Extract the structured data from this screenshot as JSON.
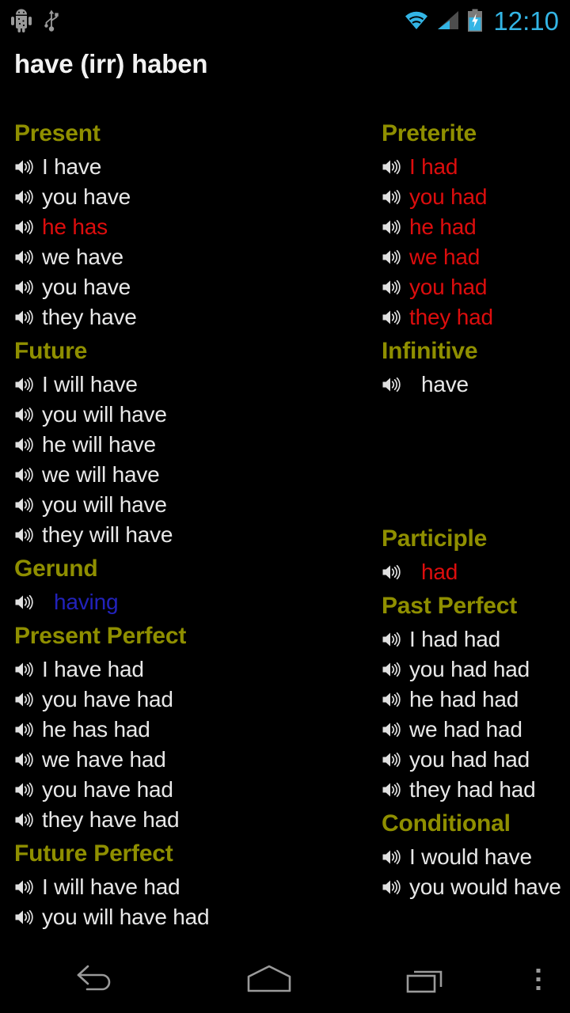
{
  "statusbar": {
    "icons": [
      "android-debug-icon",
      "usb-icon",
      "wifi-icon",
      "cellular-signal-icon",
      "battery-charging-icon"
    ],
    "clock": "12:10",
    "accent_color": "#33b5e5"
  },
  "header": {
    "title": "have (irr) haben"
  },
  "colors": {
    "section_heading": "#8f8f00",
    "regular_form": "#e8e8e8",
    "irregular_form": "#dd0d0d",
    "gerund_form": "#2222bb",
    "background": "#000000"
  },
  "icons": {
    "speaker": "speaker-icon",
    "back": "back-icon",
    "home": "home-icon",
    "recent": "recent-apps-icon",
    "menu": "overflow-menu-icon"
  },
  "left_column": [
    {
      "heading": "Present",
      "rows": [
        {
          "text": "I have",
          "color": "regular"
        },
        {
          "text": "you have",
          "color": "regular"
        },
        {
          "text": "he has",
          "color": "irregular"
        },
        {
          "text": "we have",
          "color": "regular"
        },
        {
          "text": "you have",
          "color": "regular"
        },
        {
          "text": "they have",
          "color": "regular"
        }
      ]
    },
    {
      "heading": "Future",
      "rows": [
        {
          "text": "I will have",
          "color": "regular"
        },
        {
          "text": "you will have",
          "color": "regular"
        },
        {
          "text": "he will have",
          "color": "regular"
        },
        {
          "text": "we will have",
          "color": "regular"
        },
        {
          "text": "you will have",
          "color": "regular"
        },
        {
          "text": "they will have",
          "color": "regular"
        }
      ]
    },
    {
      "heading": "Gerund",
      "rows": [
        {
          "text": "having",
          "color": "gerund",
          "single": true
        }
      ]
    },
    {
      "heading": "Present Perfect",
      "rows": [
        {
          "text": "I have had",
          "color": "regular"
        },
        {
          "text": "you have had",
          "color": "regular"
        },
        {
          "text": "he has had",
          "color": "regular"
        },
        {
          "text": "we have had",
          "color": "regular"
        },
        {
          "text": "you have had",
          "color": "regular"
        },
        {
          "text": "they have had",
          "color": "regular"
        }
      ]
    },
    {
      "heading": "Future Perfect",
      "rows": [
        {
          "text": "I will have had",
          "color": "regular"
        },
        {
          "text": "you will have had",
          "color": "regular"
        }
      ]
    }
  ],
  "right_column": [
    {
      "heading": "Preterite",
      "rows": [
        {
          "text": "I had",
          "color": "irregular"
        },
        {
          "text": "you had",
          "color": "irregular"
        },
        {
          "text": "he had",
          "color": "irregular"
        },
        {
          "text": "we had",
          "color": "irregular"
        },
        {
          "text": "you had",
          "color": "irregular"
        },
        {
          "text": "they had",
          "color": "irregular"
        }
      ]
    },
    {
      "heading": "Infinitive",
      "rows": [
        {
          "text": "have",
          "color": "regular",
          "single": true
        }
      ],
      "filler": true
    },
    {
      "heading": "Participle",
      "rows": [
        {
          "text": "had",
          "color": "irregular",
          "single": true
        }
      ]
    },
    {
      "heading": "Past Perfect",
      "rows": [
        {
          "text": "I had had",
          "color": "regular"
        },
        {
          "text": "you had had",
          "color": "regular"
        },
        {
          "text": "he had had",
          "color": "regular"
        },
        {
          "text": "we had had",
          "color": "regular"
        },
        {
          "text": "you had had",
          "color": "regular"
        },
        {
          "text": "they had had",
          "color": "regular"
        }
      ]
    },
    {
      "heading": "Conditional",
      "rows": [
        {
          "text": "I would have",
          "color": "regular"
        },
        {
          "text": "you would have",
          "color": "regular"
        }
      ]
    }
  ]
}
